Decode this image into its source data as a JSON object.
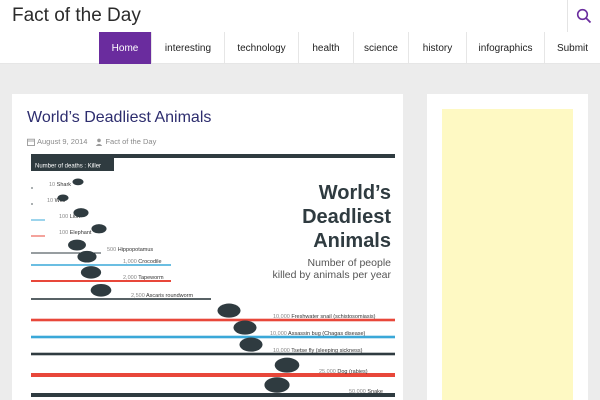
{
  "site": {
    "title": "Fact of the Day"
  },
  "nav": {
    "items": [
      "Home",
      "interesting",
      "technology",
      "health",
      "science",
      "history",
      "infographics",
      "Submit"
    ],
    "active_index": 0
  },
  "post": {
    "title": "World’s Deadliest Animals",
    "date": "August 9, 2014",
    "author": "Fact of the Day"
  },
  "infographic": {
    "header": "Number of deaths : Killer",
    "title_lines": [
      "World’s",
      "Deadliest",
      "Animals"
    ],
    "subtitle_lines": [
      "Number of people",
      "killed by animals per year"
    ],
    "rows": [
      {
        "count": "10",
        "animal": "Shark",
        "deaths": 10,
        "icon": "shark-icon"
      },
      {
        "count": "10",
        "animal": "Wolf",
        "deaths": 10,
        "icon": "wolf-icon"
      },
      {
        "count": "100",
        "animal": "Lion",
        "deaths": 100,
        "icon": "lion-icon"
      },
      {
        "count": "100",
        "animal": "Elephant",
        "deaths": 100,
        "icon": "elephant-icon"
      },
      {
        "count": "500",
        "animal": "Hippopotamus",
        "deaths": 500,
        "icon": "hippo-icon"
      },
      {
        "count": "1,000",
        "animal": "Crocodile",
        "deaths": 1000,
        "icon": "crocodile-icon"
      },
      {
        "count": "2,000",
        "animal": "Tapeworm",
        "deaths": 2000,
        "icon": "tapeworm-icon"
      },
      {
        "count": "2,500",
        "animal": "Ascaris roundworm",
        "deaths": 2500,
        "icon": "roundworm-icon"
      },
      {
        "count": "10,000",
        "animal": "Freshwater snail (schistosomiasis)",
        "deaths": 10000,
        "icon": "snail-icon"
      },
      {
        "count": "10,000",
        "animal": "Assassin bug (Chagas disease)",
        "deaths": 10000,
        "icon": "assassin-bug-icon"
      },
      {
        "count": "10,000",
        "animal": "Tsetse fly (sleeping sickness)",
        "deaths": 10000,
        "icon": "tsetse-fly-icon"
      },
      {
        "count": "25,000",
        "animal": "Dog (rabies)",
        "deaths": 25000,
        "icon": "dog-icon"
      },
      {
        "count": "50,000",
        "animal": "Snake",
        "deaths": 50000,
        "icon": "snake-icon"
      }
    ],
    "colors": {
      "dark": "#2f3b40",
      "blue": "#3aa8d8",
      "red": "#e8473a",
      "accent": "#6a2c9e"
    }
  }
}
